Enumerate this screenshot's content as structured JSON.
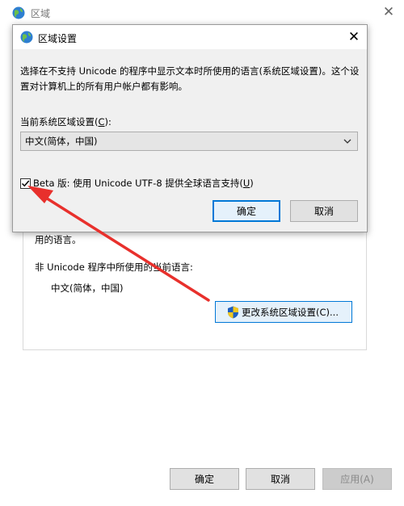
{
  "background_window": {
    "title": "区域",
    "close_glyph": "✕",
    "partial_text": "用的语言。",
    "non_unicode_label": "非 Unicode 程序中所使用的当前语言:",
    "current_language": "中文(简体，中国)",
    "change_button_label": "更改系统区域设置(C)...",
    "ok_label": "确定",
    "cancel_label": "取消",
    "apply_label": "应用(A)"
  },
  "dialog": {
    "title": "区域设置",
    "close_glyph": "✕",
    "description": "选择在不支持 Unicode 的程序中显示文本时所使用的语言(系统区域设置)。这个设置对计算机上的所有用户帐户都有影响。",
    "label_prefix": "当前系统区域设置(",
    "label_key": "C",
    "label_suffix": "):",
    "selected_locale": "中文(简体，中国)",
    "beta_checkbox_checked": true,
    "beta_prefix": "Beta 版: 使用 Unicode UTF-8 提供全球语言支持(",
    "beta_key": "U",
    "beta_suffix": ")",
    "ok_label": "确定",
    "cancel_label": "取消"
  },
  "colors": {
    "accent": "#0078d7",
    "annotation_arrow": "#e8302c",
    "dialog_bg": "#f0f0f0"
  },
  "icons": [
    "globe-icon",
    "close-icon",
    "chevron-down-icon",
    "checkmark-icon",
    "uac-shield-icon",
    "red-arrow-annotation"
  ]
}
